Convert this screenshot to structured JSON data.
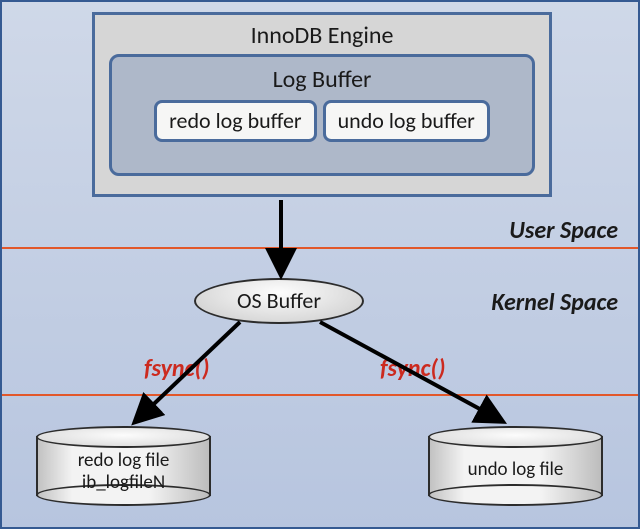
{
  "diagram": {
    "engine_title": "InnoDB Engine",
    "log_buffer_title": "Log Buffer",
    "redo_buffer": "redo log buffer",
    "undo_buffer": "undo log buffer",
    "os_buffer": "OS Buffer",
    "user_space": "User Space",
    "kernel_space": "Kernel Space",
    "fsync_left": "fsync()",
    "fsync_right": "fsync()",
    "redo_file_line1": "redo log file",
    "redo_file_line2": "ib_logfileN",
    "undo_file": "undo log file"
  }
}
